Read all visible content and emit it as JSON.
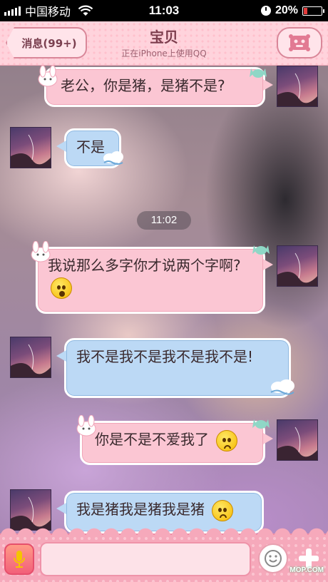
{
  "status_bar": {
    "carrier": "中国移动",
    "time": "11:03",
    "battery_percent": "20%",
    "battery_level": 0.2
  },
  "nav": {
    "back_label": "消息(99+)",
    "title": "宝贝",
    "subtitle": "正在iPhone上使用QQ"
  },
  "messages": [
    {
      "side": "me",
      "text": "老公，你是猪，是猪不是?"
    },
    {
      "side": "them",
      "text": "不是"
    },
    {
      "side": "time",
      "text": "11:02"
    },
    {
      "side": "me",
      "text": "我说那么多字你才说两个字啊?",
      "emoji": "surprised-face"
    },
    {
      "side": "them",
      "text": "我不是我不是我不是我不是!"
    },
    {
      "side": "me",
      "text": "你是不是不爱我了",
      "emoji": "sad-face"
    },
    {
      "side": "them",
      "text": "我是猪我是猪我是猪",
      "emoji": "dizzy-face"
    }
  ],
  "input": {
    "placeholder": ""
  },
  "watermark": "MOP.COM",
  "colors": {
    "my_bubble": "#fbc6d3",
    "their_bubble": "#bcd9f5",
    "nav_bg": "#ffd3dc",
    "input_bar": "#f6a9bb"
  }
}
